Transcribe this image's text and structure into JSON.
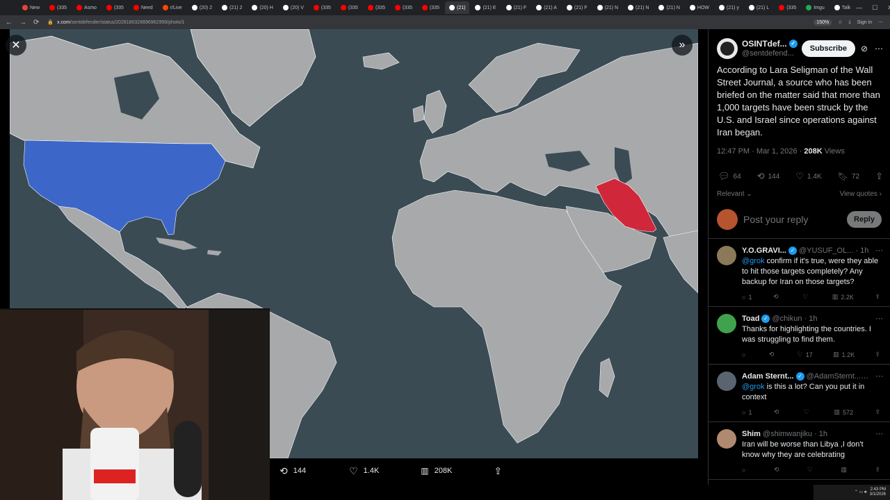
{
  "browser": {
    "tabs": [
      "New",
      "(335",
      "Asmo",
      "(335",
      "Need",
      "r/Live",
      "(20) 2",
      "(21) 2",
      "(20) H",
      "(20) V",
      "(335",
      "(335",
      "(335",
      "(335",
      "(335",
      "(21)",
      "(21) E",
      "(21) F",
      "(21) A",
      "(21) F",
      "(21) N",
      "(21) N",
      "(21) N",
      "HOW",
      "(21) y",
      "(21) L",
      "(335",
      "Imgu",
      "Talk"
    ],
    "active_tab_index": 15,
    "url_host": "x.com",
    "url_path": "/sentdefender/status/2028180328896962999/photo/1",
    "zoom": "150%",
    "sign_in": "Sign in"
  },
  "viewer": {
    "close_icon": "close-icon",
    "expand_icon": "double-chevron-right-icon",
    "highlight_colors": {
      "usa": "#3d66c9",
      "iran": "#d0283a",
      "land": "#a7a9ab",
      "sea": "#3a4b54"
    },
    "actions": {
      "reposts": "144",
      "likes": "1.4K",
      "views": "208K"
    }
  },
  "post": {
    "author_name": "OSINTdef...",
    "author_handle": "@sentdefend...",
    "subscribe_label": "Subscribe",
    "text": "According to Lara Seligman of the Wall Street Journal, a source who has been briefed on the matter said that more than 1,000 targets have been struck by the U.S. and Israel since operations against Iran began.",
    "time": "12:47 PM · Mar 1, 2026 · ",
    "views_count": "208K",
    "views_label": " Views",
    "stats": {
      "replies": "64",
      "reposts": "144",
      "likes": "1.4K",
      "bookmarks": "72"
    },
    "sort_label": "Relevant",
    "view_quotes": "View quotes",
    "reply_placeholder": "Post your reply",
    "reply_button": "Reply"
  },
  "replies": [
    {
      "name": "Y.O.GRAVI...",
      "meta": "@YUSUF_OL... · 1h",
      "mention": "@grok",
      "text": " confirm if it's true, were they able to hit those targets completely? Any backup for Iran on those targets?",
      "stats": {
        "replies": "1",
        "reposts": "",
        "likes": "",
        "views": "2.2K"
      },
      "avatar_color": "#8a7a5a"
    },
    {
      "name": "Toad",
      "meta": "@chikun · 1h",
      "mention": "",
      "text": "Thanks for highlighting the countries. I was struggling to find them.",
      "stats": {
        "replies": "",
        "reposts": "",
        "likes": "17",
        "views": "1.2K"
      },
      "avatar_color": "#3fa34d"
    },
    {
      "name": "Adam Sternt...",
      "meta": "@AdamSternt... · 1h",
      "mention": "@grok",
      "text": " is this a lot? Can you put it in context",
      "stats": {
        "replies": "1",
        "reposts": "",
        "likes": "",
        "views": "572"
      },
      "avatar_color": "#5a6470"
    },
    {
      "name": "Shim",
      "meta": "@shimwanjiku · 1h",
      "mention": "",
      "text": "Iran will be worse than Libya ,I don't know why they are celebrating",
      "stats": {
        "replies": "",
        "reposts": "",
        "likes": "",
        "views": ""
      },
      "avatar_color": "#b08a70"
    }
  ],
  "taskbar": {
    "time": "2:43 PM",
    "date": "3/1/2026"
  }
}
